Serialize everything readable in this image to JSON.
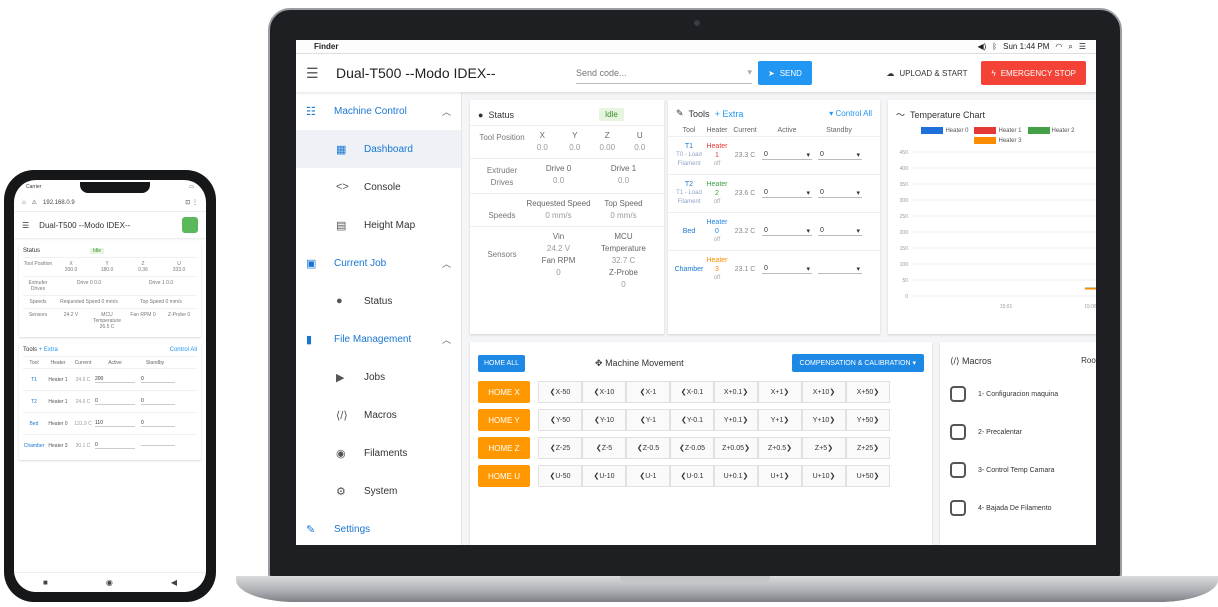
{
  "macbar": {
    "app": "Finder",
    "time": "Sun 1:44 PM"
  },
  "toolbar": {
    "title": "Dual-T500 --Modo IDEX--",
    "gcode_placeholder": "Send code...",
    "send": "SEND",
    "upload": "UPLOAD & START",
    "estop": "EMERGENCY STOP"
  },
  "sidebar": {
    "machine_control": "Machine Control",
    "dashboard": "Dashboard",
    "console": "Console",
    "height_map": "Height Map",
    "current_job": "Current Job",
    "status": "Status",
    "file_management": "File Management",
    "jobs": "Jobs",
    "macros": "Macros",
    "filaments": "Filaments",
    "system": "System",
    "settings": "Settings"
  },
  "status": {
    "title": "Status",
    "state": "Idle",
    "tool_position_label": "Tool Position",
    "axes": [
      "X",
      "Y",
      "Z",
      "U"
    ],
    "positions": [
      "0.0",
      "0.0",
      "0.00",
      "0.0"
    ],
    "extruder_label": "Extruder Drives",
    "drives": [
      {
        "name": "Drive 0",
        "value": "0.0"
      },
      {
        "name": "Drive 1",
        "value": "0.0"
      }
    ],
    "speeds_label": "Speeds",
    "requested_speed_label": "Requested Speed",
    "requested_speed": "0 mm/s",
    "top_speed_label": "Top Speed",
    "top_speed": "0 mm/s",
    "sensors_label": "Sensors",
    "vin_label": "Vin",
    "vin": "24.2 V",
    "mcu_label": "MCU Temperature",
    "mcu": "32.7 C",
    "fan_label": "Fan RPM",
    "fan": "0",
    "zprobe_label": "Z-Probe",
    "zprobe": "0"
  },
  "tools": {
    "title": "Tools",
    "extra": "+ Extra",
    "control_all": "Control All",
    "headers": [
      "Tool",
      "Heater",
      "Current",
      "Active",
      "Standby"
    ],
    "rows": [
      {
        "name": "T1",
        "sub1": "T0 - Load",
        "sub2": "Filament",
        "heater": "Heater 1",
        "state": "off",
        "current": "23.3 C",
        "active": "0",
        "standby": "0",
        "color": "#e53935"
      },
      {
        "name": "T2",
        "sub1": "T1 - Load",
        "sub2": "Filament",
        "heater": "Heater 2",
        "state": "off",
        "current": "23.6 C",
        "active": "0",
        "standby": "0",
        "color": "#43a047"
      },
      {
        "name": "Bed",
        "sub1": "",
        "sub2": "",
        "heater": "Heater 0",
        "state": "off",
        "current": "23.2 C",
        "active": "0",
        "standby": "0",
        "color": "#1e88e5"
      },
      {
        "name": "Chamber",
        "sub1": "",
        "sub2": "",
        "heater": "Heater 3",
        "state": "off",
        "current": "23.1 C",
        "active": "0",
        "standby": "",
        "color": "#fb8c00"
      }
    ]
  },
  "chart_data": {
    "type": "line",
    "title": "Temperature Chart",
    "series": [
      {
        "name": "Heater 0",
        "color": "#1e6fd9",
        "values": [
          23.2,
          23.2
        ]
      },
      {
        "name": "Heater 1",
        "color": "#e53935",
        "values": [
          23.3,
          23.3
        ]
      },
      {
        "name": "Heater 2",
        "color": "#43a047",
        "values": [
          23.6,
          23.6
        ]
      },
      {
        "name": "Heater 3",
        "color": "#fb8c00",
        "values": [
          23.1,
          23.1
        ]
      }
    ],
    "yticks": [
      "450",
      "400",
      "350",
      "300",
      "250",
      "200",
      "150",
      "100",
      "50",
      "0"
    ],
    "xticks": [
      "15:01",
      "15:06"
    ],
    "ylim": [
      0,
      450
    ],
    "grid": true
  },
  "movement": {
    "home_all": "HOME ALL",
    "title": "Machine Movement",
    "comp": "COMPENSATION & CALIBRATION",
    "rows": [
      {
        "home": "HOME X",
        "steps": [
          "X-50",
          "X-10",
          "X-1",
          "X-0.1",
          "X+0.1",
          "X+1",
          "X+10",
          "X+50"
        ]
      },
      {
        "home": "HOME Y",
        "steps": [
          "Y-50",
          "Y-10",
          "Y-1",
          "Y-0.1",
          "Y+0.1",
          "Y+1",
          "Y+10",
          "Y+50"
        ]
      },
      {
        "home": "HOME Z",
        "steps": [
          "Z-25",
          "Z-5",
          "Z-0.5",
          "Z-0.05",
          "Z+0.05",
          "Z+0.5",
          "Z+5",
          "Z+25"
        ]
      },
      {
        "home": "HOME U",
        "steps": [
          "U-50",
          "U-10",
          "U-1",
          "U-0.1",
          "U+0.1",
          "U+1",
          "U+10",
          "U+50"
        ]
      }
    ]
  },
  "macros": {
    "title": "Macros",
    "root": "Root",
    "items": [
      "1- Configuracion maquina",
      "2- Precalentar",
      "3- Control Temp Camara",
      "4- Bajada De Filamento"
    ]
  },
  "phone": {
    "carrier": "Carrier",
    "url": "192.168.0.9",
    "title": "Dual-T500 --Modo IDEX--",
    "status_title": "Status",
    "state": "Idle",
    "tool_pos_label": "Tool Position",
    "axes": [
      "X",
      "Y",
      "Z",
      "U"
    ],
    "positions": [
      "200.0",
      "180.0",
      "0.36",
      "333.0"
    ],
    "extruder_label": "Extruder Drives",
    "drives": [
      "Drive 0 0.0",
      "Drive 1 0.0"
    ],
    "speeds_label": "Speeds",
    "req_speed": "Requested Speed 0 mm/s",
    "top_speed": "Top Speed 0 mm/s",
    "sensors_label": "Sensors",
    "vin": "24.2 V",
    "mcu": "MCU Temperature 26.5 C",
    "fan": "Fan RPM 0",
    "probe": "Z-Probe 0",
    "tools_title": "Tools",
    "extra": "+ Extra",
    "control_all": "Control All",
    "tool_headers": [
      "Tool",
      "Heater",
      "Current",
      "Active",
      "Standby"
    ],
    "tool_rows": [
      {
        "name": "T1",
        "heater": "Heater 1",
        "cur": "24.6 C",
        "active": "200",
        "standby": "0"
      },
      {
        "name": "T2",
        "heater": "Heater 1",
        "cur": "24.6 C",
        "active": "0",
        "standby": "0"
      },
      {
        "name": "Bed",
        "heater": "Heater 0",
        "cur": "131.9 C",
        "active": "110",
        "standby": "0"
      },
      {
        "name": "Chamber",
        "heater": "Heater 3",
        "cur": "30.1 C",
        "active": "0",
        "standby": ""
      }
    ]
  }
}
